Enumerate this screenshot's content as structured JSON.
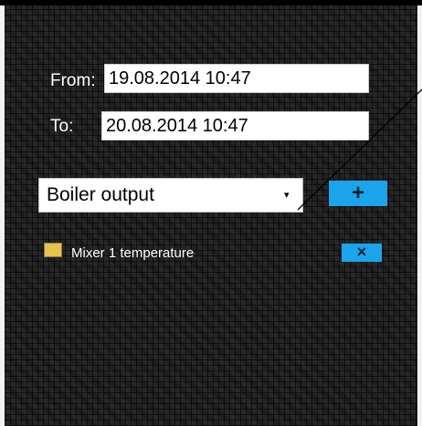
{
  "range": {
    "from_label": "From:",
    "from_value": "19.08.2014 10:47",
    "to_label": "To:",
    "to_value": "20.08.2014 10:47"
  },
  "series_select": {
    "selected": "Boiler output",
    "arrow": "▾"
  },
  "buttons": {
    "add_label": "+",
    "remove_label": "×"
  },
  "legend": {
    "items": [
      {
        "label": "Mixer 1 temperature",
        "color": "#e6c34a"
      }
    ]
  },
  "colors": {
    "accent": "#1aa4ec",
    "panel_background": "#202020"
  }
}
